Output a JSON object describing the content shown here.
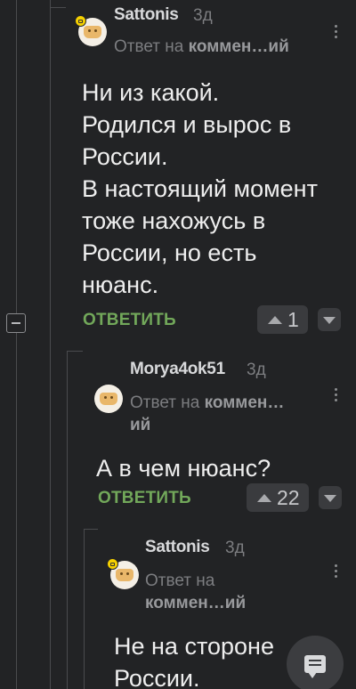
{
  "comments": [
    {
      "author": "Sattonis",
      "time": "3д",
      "reply_prefix": "Ответ на",
      "reply_target": "коммен…ий",
      "text": [
        "Ни из какой.",
        "Родился и вырос в",
        "России.",
        "В настоящий момент",
        "тоже нахожусь в",
        "России, но есть",
        "нюанс."
      ],
      "reply_label": "ОТВЕТИТЬ",
      "votes": "1"
    },
    {
      "author": "Morya4ok51",
      "time": "3д",
      "reply_prefix": "Ответ на",
      "reply_target": "коммен…",
      "reply_target_cont": "ий",
      "text": [
        "А в чем нюанс?"
      ],
      "reply_label": "ОТВЕТИТЬ",
      "votes": "22"
    },
    {
      "author": "Sattonis",
      "time": "3д",
      "reply_prefix": "Ответ на",
      "reply_target": "коммен…ий",
      "text": [
        "Не на стороне",
        "России."
      ]
    }
  ],
  "icons": {
    "upvote": "triangle-up-icon",
    "downvote": "triangle-down-icon",
    "menu": "kebab-menu-icon",
    "collapse": "collapse-minus-icon",
    "fab": "comment-icon"
  },
  "colors": {
    "background": "#222325",
    "reply_green": "#72a85a"
  }
}
